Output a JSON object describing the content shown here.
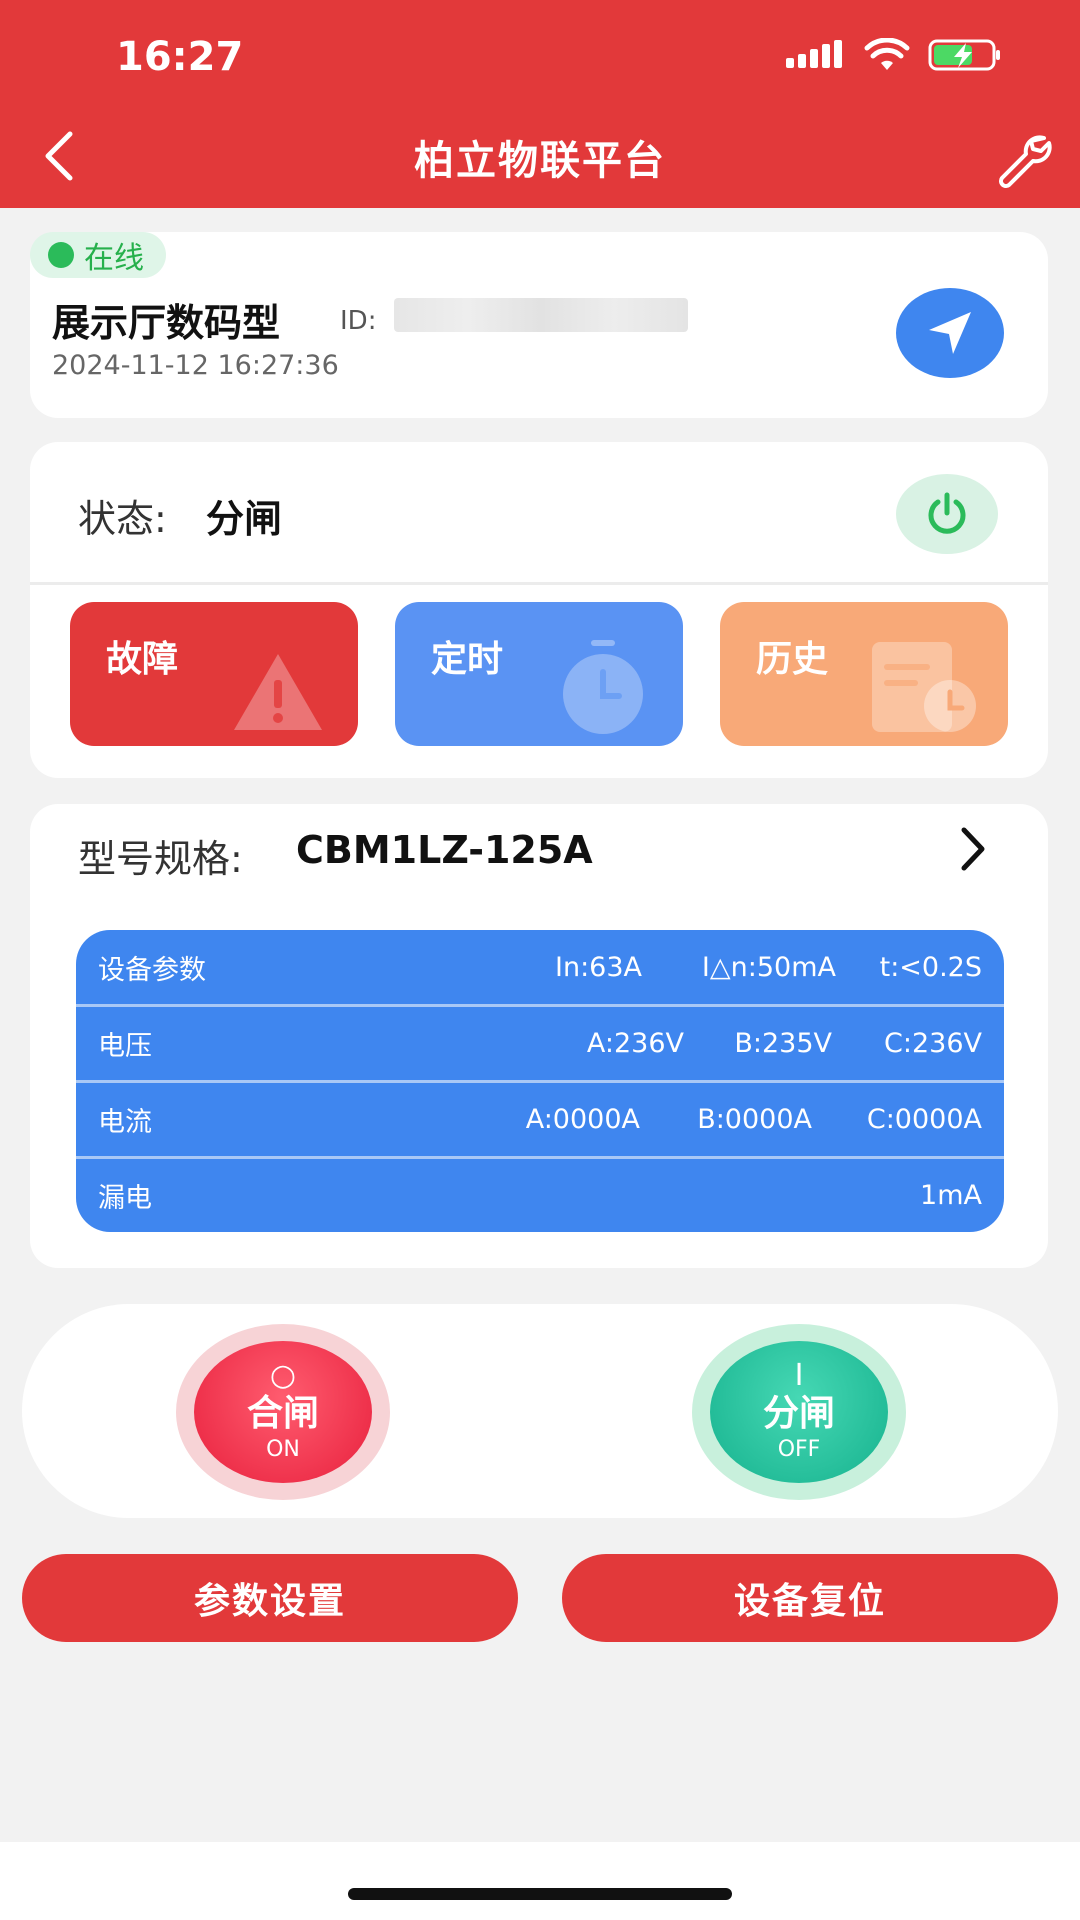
{
  "status_bar": {
    "time": "16:27"
  },
  "header": {
    "title": "柏立物联平台"
  },
  "device": {
    "online_label": "在线",
    "name": "展示厅数码型",
    "id_label": "ID:",
    "timestamp": "2024-11-12 16:27:36"
  },
  "state": {
    "label": "状态:",
    "value": "分闸"
  },
  "tiles": {
    "fault": "故障",
    "timer": "定时",
    "history": "历史"
  },
  "model": {
    "label": "型号规格:",
    "value": "CBM1LZ-125A"
  },
  "params": {
    "rows": [
      {
        "label": "设备参数",
        "values": [
          "In:63A",
          "I△n:50mA",
          "t:<0.2S"
        ]
      },
      {
        "label": "电压",
        "values": [
          "A:236V",
          "B:235V",
          "C:236V"
        ]
      },
      {
        "label": "电流",
        "values": [
          "A:0000A",
          "B:0000A",
          "C:0000A"
        ]
      },
      {
        "label": "漏电",
        "values": [
          "1mA"
        ]
      }
    ]
  },
  "switches": {
    "on": {
      "symbol": "○",
      "cn": "合闸",
      "en": "ON"
    },
    "off": {
      "symbol": "I",
      "cn": "分闸",
      "en": "OFF"
    }
  },
  "actions": {
    "params": "参数设置",
    "reset": "设备复位"
  },
  "colors": {
    "brand_red": "#e2393a",
    "blue": "#3f86ef",
    "online_green": "#2bbb5a"
  }
}
